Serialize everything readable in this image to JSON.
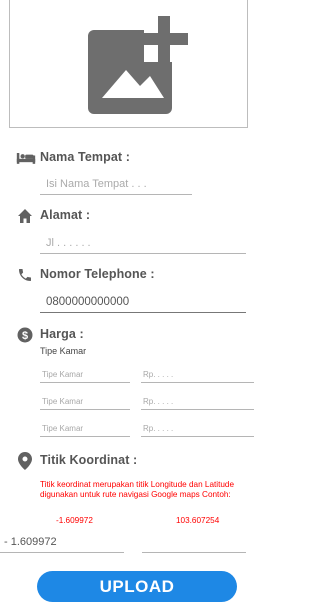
{
  "photo": {
    "icon": "add-photo-icon"
  },
  "nama_tempat": {
    "label": "Nama Tempat :",
    "placeholder": "Isi Nama Tempat . . .",
    "icon": "bed-icon"
  },
  "alamat": {
    "label": "Alamat :",
    "placeholder": "Jl . . . . . .",
    "icon": "home-icon"
  },
  "telephone": {
    "label": "Nomor Telephone :",
    "value": "0800000000000",
    "icon": "phone-icon"
  },
  "harga": {
    "label": "Harga :",
    "sublabel": "Tipe Kamar",
    "icon": "dollar-circle-icon",
    "rows": [
      {
        "type_placeholder": "Tipe Kamar",
        "price_placeholder": "Rp. . . . ."
      },
      {
        "type_placeholder": "Tipe Kamar",
        "price_placeholder": "Rp. . . . ."
      },
      {
        "type_placeholder": "Tipe Kamar",
        "price_placeholder": "Rp. . . . ."
      }
    ]
  },
  "koordinat": {
    "label": "Titik Koordinat :",
    "icon": "location-pin-icon",
    "note": "Titik keordinat merupakan titik Longitude dan Latitude digunakan untuk rute navigasi Google maps Contoh:",
    "example_lat": "-1.609972",
    "example_lng": "103.607254",
    "lat_value": "- 1.609972",
    "lng_value": ""
  },
  "upload": {
    "label": "UPLOAD"
  },
  "colors": {
    "accent": "#1e88e5",
    "icon": "#616161",
    "note": "#ff0000"
  }
}
